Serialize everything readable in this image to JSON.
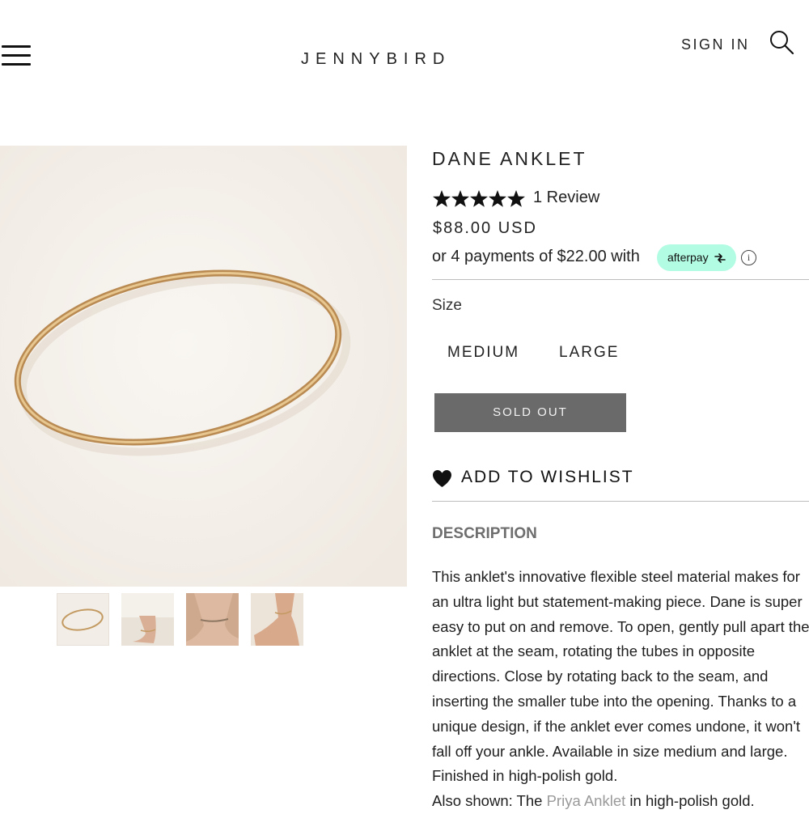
{
  "header": {
    "logo": "JENNYBIRD",
    "sign_in": "SIGN IN",
    "menu_icon": "hamburger-menu-icon",
    "search_icon": "search-icon"
  },
  "gallery": {
    "main_image": "gold-anklet-image",
    "thumbnails": [
      "anklet-flat-thumbnail",
      "anklet-on-foot-thumbnail",
      "anklet-on-ankle-thumbnail",
      "anklet-side-view-thumbnail"
    ]
  },
  "product": {
    "title": "DANE ANKLET",
    "rating": 5,
    "rating_max": 5,
    "review_count": "1 Review",
    "price": "$88.00 USD",
    "installments": "or 4 payments of $22.00 with",
    "afterpay_label": "afterpay",
    "info_icon": "info-icon",
    "size_label": "Size",
    "sizes": [
      "MEDIUM",
      "LARGE"
    ],
    "sold_out": "SOLD OUT",
    "wishlist": "ADD TO WISHLIST",
    "description_heading": "DESCRIPTION",
    "description_lines": [
      "This anklet's innovative flexible steel material makes for",
      "an ultra light but statement-making piece. Dane is super",
      "easy to put on and remove. To open, gently pull apart the",
      "anklet at the seam, rotating the tubes in opposite",
      "directions. Close by rotating back to the seam, and",
      "inserting the smaller tube into the opening. Thanks to a",
      "unique design, if the anklet ever comes undone, it won't",
      "fall off your ankle. Available in size medium and large.",
      "Finished in high-polish gold."
    ],
    "also_shown_prefix": "Also shown: The ",
    "also_shown_link": "Priya Anklet",
    "also_shown_suffix": " in high-polish gold."
  },
  "colors": {
    "afterpay": "#b2fce4",
    "sold_out_bg": "#6a6a6a",
    "link": "#9a9a9a"
  }
}
